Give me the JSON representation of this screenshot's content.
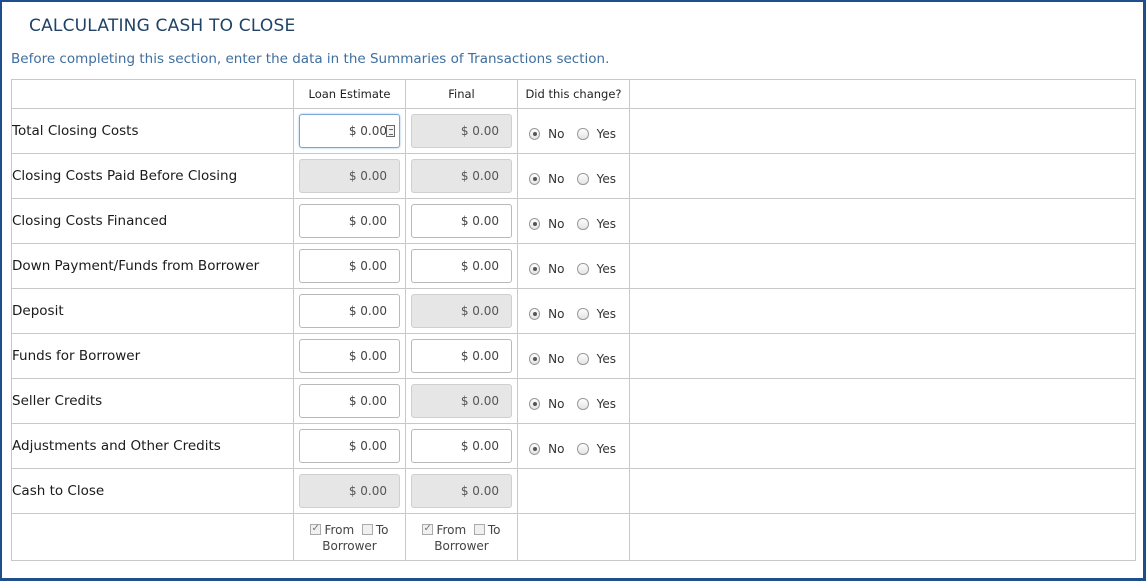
{
  "title": "CALCULATING CASH TO CLOSE",
  "subtitle": "Before completing this section, enter the data in the Summaries of Transactions section.",
  "headers": {
    "label": "",
    "loan_estimate": "Loan Estimate",
    "final": "Final",
    "changed": "Did this change?"
  },
  "radio_labels": {
    "no": "No",
    "yes": "Yes"
  },
  "rows": [
    {
      "label": "Total Closing Costs",
      "le": "$ 0.00",
      "final": "$ 0.00",
      "changed": "No"
    },
    {
      "label": "Closing Costs Paid Before Closing",
      "le": "$ 0.00",
      "final": "$ 0.00",
      "changed": "No"
    },
    {
      "label": "Closing Costs Financed",
      "le": "$ 0.00",
      "final": "$ 0.00",
      "changed": "No"
    },
    {
      "label": "Down Payment/Funds from Borrower",
      "le": "$ 0.00",
      "final": "$ 0.00",
      "changed": "No"
    },
    {
      "label": "Deposit",
      "le": "$ 0.00",
      "final": "$ 0.00",
      "changed": "No"
    },
    {
      "label": "Funds for Borrower",
      "le": "$ 0.00",
      "final": "$ 0.00",
      "changed": "No"
    },
    {
      "label": "Seller Credits",
      "le": "$ 0.00",
      "final": "$ 0.00",
      "changed": "No"
    },
    {
      "label": "Adjustments and Other Credits",
      "le": "$ 0.00",
      "final": "$ 0.00",
      "changed": "No"
    },
    {
      "label": "Cash to Close",
      "le": "$ 0.00",
      "final": "$ 0.00"
    }
  ],
  "footer": {
    "from_label": "From",
    "to_label": "To",
    "borrower_label": "Borrower",
    "le_from_checked": true,
    "le_to_checked": false,
    "final_from_checked": true,
    "final_to_checked": false
  }
}
